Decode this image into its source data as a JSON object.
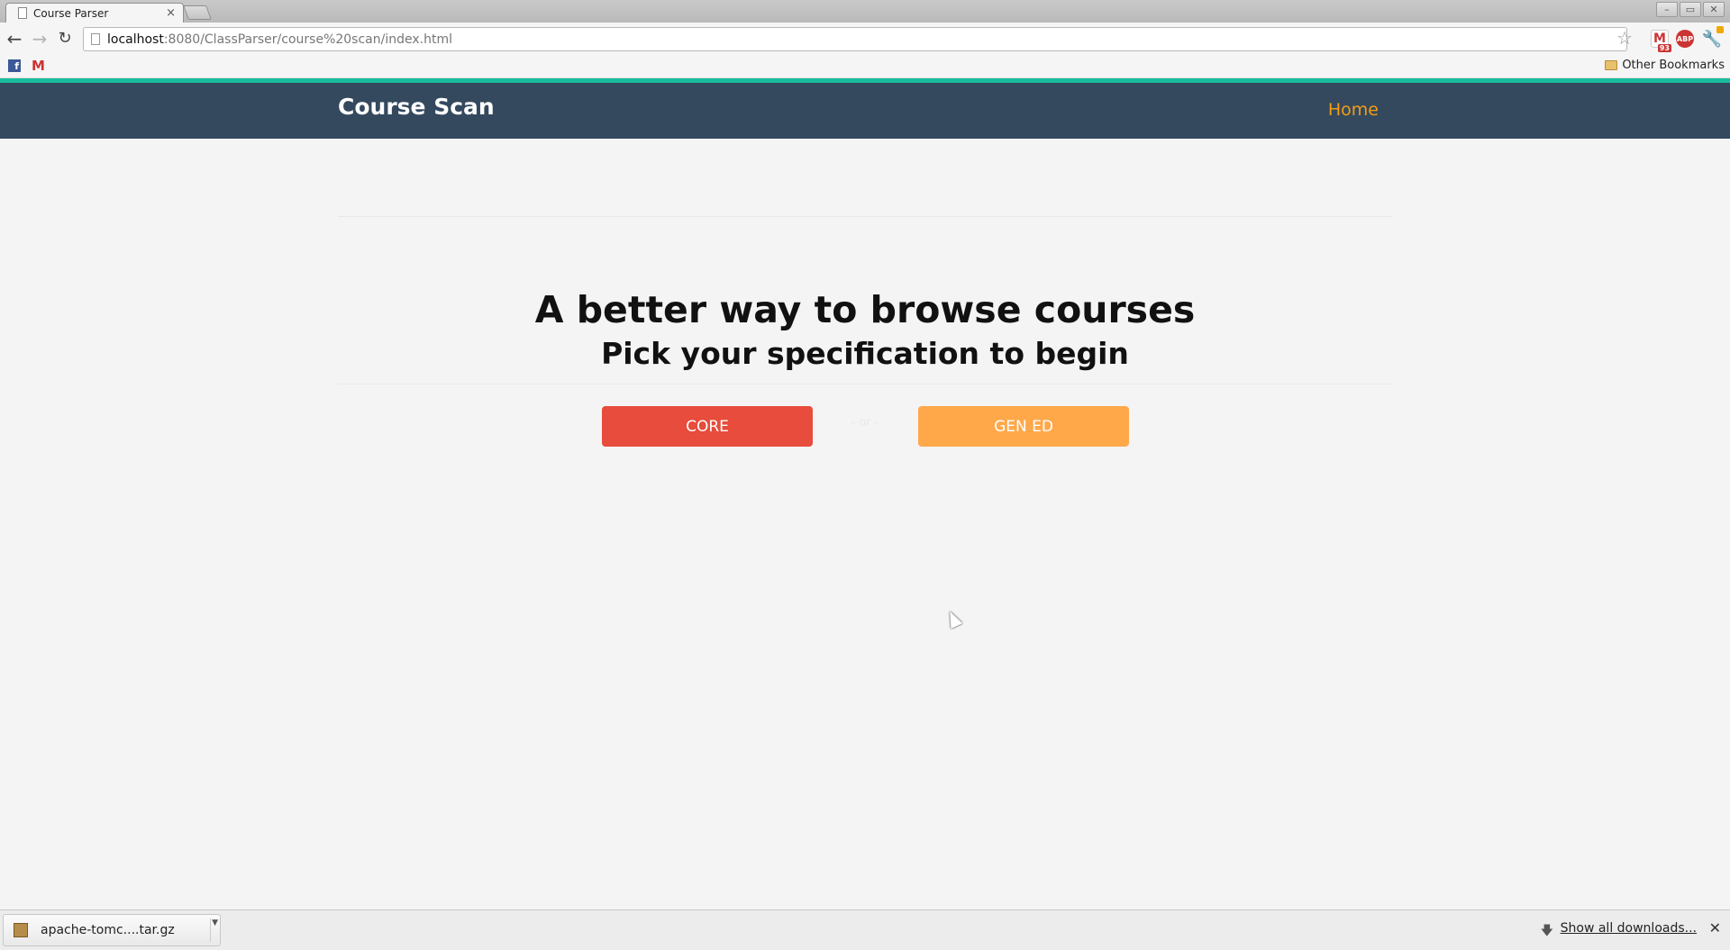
{
  "browser": {
    "tab_title": "Course Parser",
    "tab_close": "×",
    "url_host": "localhost",
    "url_rest": ":8080/ClassParser/course%20scan/index.html",
    "window_controls": [
      "–",
      "▭",
      "✕"
    ],
    "gmail_badge": "93",
    "abp_label": "ABP",
    "bookmarks": {
      "facebook_glyph": "f",
      "gmail_glyph": "M",
      "other_bookmarks": "Other Bookmarks"
    },
    "icons": {
      "back": "back-arrow-icon",
      "forward": "forward-arrow-icon",
      "reload": "reload-icon",
      "star": "star-icon",
      "wrench": "wrench-icon"
    }
  },
  "page": {
    "brand": "Course Scan",
    "nav": {
      "home": "Home"
    },
    "hero_title": "A better way to browse courses",
    "hero_subtitle": "Pick your specification to begin",
    "buttons": {
      "core": "CORE",
      "gened": "GEN ED",
      "separator": "- or -"
    },
    "colors": {
      "navbar": "#34495e",
      "navbar_accent": "#1abc9c",
      "home_link": "#f39c12",
      "core_button": "#e74c3c",
      "gened_button": "#ffa84a"
    }
  },
  "downloads": {
    "file_name": "apache-tomc....tar.gz",
    "show_all": "Show all downloads...",
    "close": "✕"
  }
}
